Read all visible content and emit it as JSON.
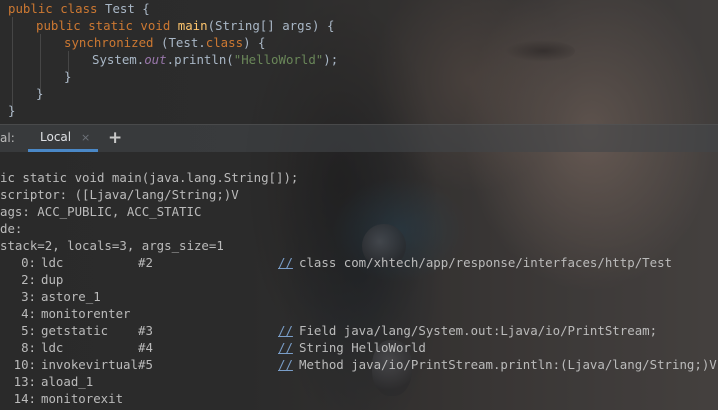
{
  "editor": {
    "line1": {
      "kw": "public class ",
      "name": "Test {"
    },
    "line2": {
      "kw": "public static void ",
      "fn": "main",
      "rest": "(String[] args) {"
    },
    "line3": {
      "kw": "synchronized ",
      "rest": "(Test.",
      "kw2": "class",
      "rest2": ") {"
    },
    "line4": {
      "a": "System.",
      "fld": "out",
      "b": ".println(",
      "str": "\"HelloWorld\"",
      "c": ");"
    },
    "line5": {
      "brace": "}"
    },
    "line6": {
      "brace": "}"
    },
    "line7": {
      "brace": "}"
    }
  },
  "terminal_tabs": {
    "prefix": "al:",
    "active_tab": "Local",
    "close_glyph": "×",
    "add_glyph": "+",
    "accent": "#4a88c7"
  },
  "terminal": {
    "header": [
      "ic static void main(java.lang.String[]);",
      "scriptor: ([Ljava/lang/String;)V",
      "ags: ACC_PUBLIC, ACC_STATIC",
      "de:",
      "stack=2, locals=3, args_size=1"
    ],
    "instructions": [
      {
        "offset": "0:",
        "op": "ldc",
        "arg": "#2",
        "comment": "//",
        "desc": "class com/xhtech/app/response/interfaces/http/Test"
      },
      {
        "offset": "2:",
        "op": "dup",
        "arg": "",
        "comment": "",
        "desc": ""
      },
      {
        "offset": "3:",
        "op": "astore_1",
        "arg": "",
        "comment": "",
        "desc": ""
      },
      {
        "offset": "4:",
        "op": "monitorenter",
        "arg": "",
        "comment": "",
        "desc": ""
      },
      {
        "offset": "5:",
        "op": "getstatic",
        "arg": "#3",
        "comment": "//",
        "desc": "Field java/lang/System.out:Ljava/io/PrintStream;"
      },
      {
        "offset": "8:",
        "op": "ldc",
        "arg": "#4",
        "comment": "//",
        "desc": "String HelloWorld"
      },
      {
        "offset": "10:",
        "op": "invokevirtual",
        "arg": "#5",
        "comment": "//",
        "desc": "Method java/io/PrintStream.println:(Ljava/lang/String;)V"
      },
      {
        "offset": "13:",
        "op": "aload_1",
        "arg": "",
        "comment": "",
        "desc": ""
      },
      {
        "offset": "14:",
        "op": "monitorexit",
        "arg": "",
        "comment": "",
        "desc": ""
      }
    ]
  }
}
